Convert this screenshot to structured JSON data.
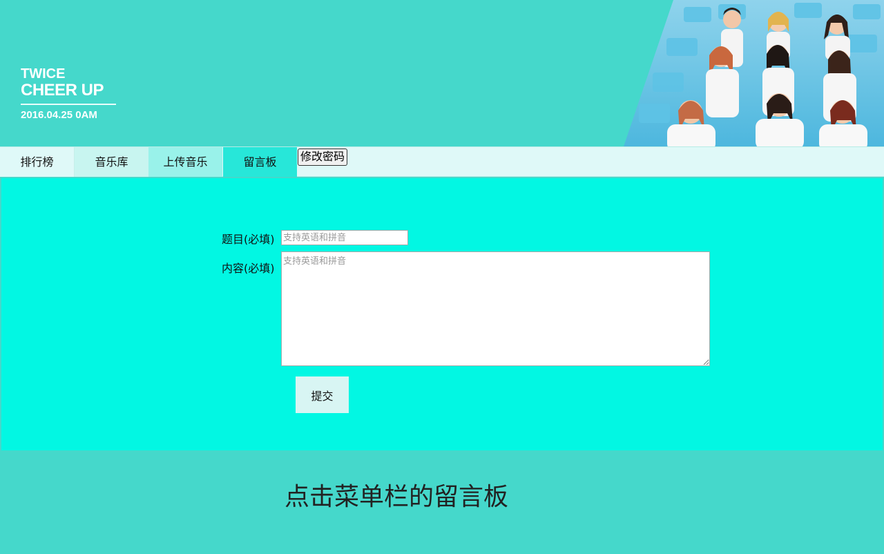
{
  "banner": {
    "brand_line1": "TWICE",
    "brand_line2": "CHEER UP",
    "date": "2016.04.25 0AM",
    "background_color": "#45d8cb"
  },
  "nav": {
    "items": [
      {
        "label": "排行榜"
      },
      {
        "label": "音乐库"
      },
      {
        "label": "上传音乐"
      },
      {
        "label": "留言板"
      }
    ],
    "change_password": "修改密码"
  },
  "form": {
    "title_label": "题目(必填)",
    "title_placeholder": "支持英语和拼音",
    "content_label": "内容(必填)",
    "content_placeholder": "支持英语和拼音",
    "submit_label": "提交",
    "background_color": "#02f7e3"
  },
  "caption": "点击菜单栏的留言板"
}
